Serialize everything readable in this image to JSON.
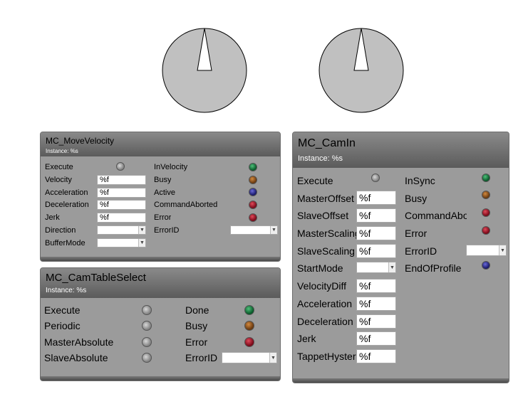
{
  "mc_movevelocity": {
    "title": "MC_MoveVelocity",
    "instance": "Instance: %s",
    "inputs": {
      "execute": "Execute",
      "velocity": "Velocity",
      "velocity_value": "%f",
      "acceleration": "Acceleration",
      "acceleration_value": "%f",
      "deceleration": "Deceleration",
      "deceleration_value": "%f",
      "jerk": "Jerk",
      "jerk_value": "%f",
      "direction": "Direction",
      "buffermode": "BufferMode"
    },
    "outputs": {
      "invelocity": "InVelocity",
      "busy": "Busy",
      "active": "Active",
      "commandaborted": "CommandAborted",
      "error": "Error",
      "errorid": "ErrorID"
    }
  },
  "mc_camtableselect": {
    "title": "MC_CamTableSelect",
    "instance": "Instance: %s",
    "inputs": {
      "execute": "Execute",
      "periodic": "Periodic",
      "masterabsolute": "MasterAbsolute",
      "slaveabsolute": "SlaveAbsolute"
    },
    "outputs": {
      "done": "Done",
      "busy": "Busy",
      "error": "Error",
      "errorid": "ErrorID"
    }
  },
  "mc_camin": {
    "title": "MC_CamIn",
    "instance": "Instance: %s",
    "inputs": {
      "execute": "Execute",
      "masteroffset": "MasterOffset",
      "masteroffset_value": "%f",
      "slaveoffset": "SlaveOffset",
      "slaveoffset_value": "%f",
      "masterscaling": "MasterScaling",
      "masterscaling_value": "%f",
      "slavescaling": "SlaveScaling",
      "slavescaling_value": "%f",
      "startmode": "StartMode",
      "velocitydiff": "VelocityDiff",
      "velocitydiff_value": "%f",
      "acceleration": "Acceleration",
      "acceleration_value": "%f",
      "deceleration": "Deceleration",
      "deceleration_value": "%f",
      "jerk": "Jerk",
      "jerk_value": "%f",
      "tappethysteresis": "TappetHysteresis",
      "tappethysteresis_value": "%f"
    },
    "outputs": {
      "insync": "InSync",
      "busy": "Busy",
      "commandaborted": "CommandAborted",
      "error": "Error",
      "errorid": "ErrorID",
      "endofprofile": "EndOfProfile"
    }
  },
  "colors": {
    "panel_bg": "#9b9b9b",
    "dial_fill": "#c0c0c0",
    "led_green": "#0a5a2a",
    "led_brown": "#6a3a10",
    "led_blue": "#1a1a6a",
    "led_red": "#7a0a1a",
    "led_gray": "#8a8a8a"
  }
}
